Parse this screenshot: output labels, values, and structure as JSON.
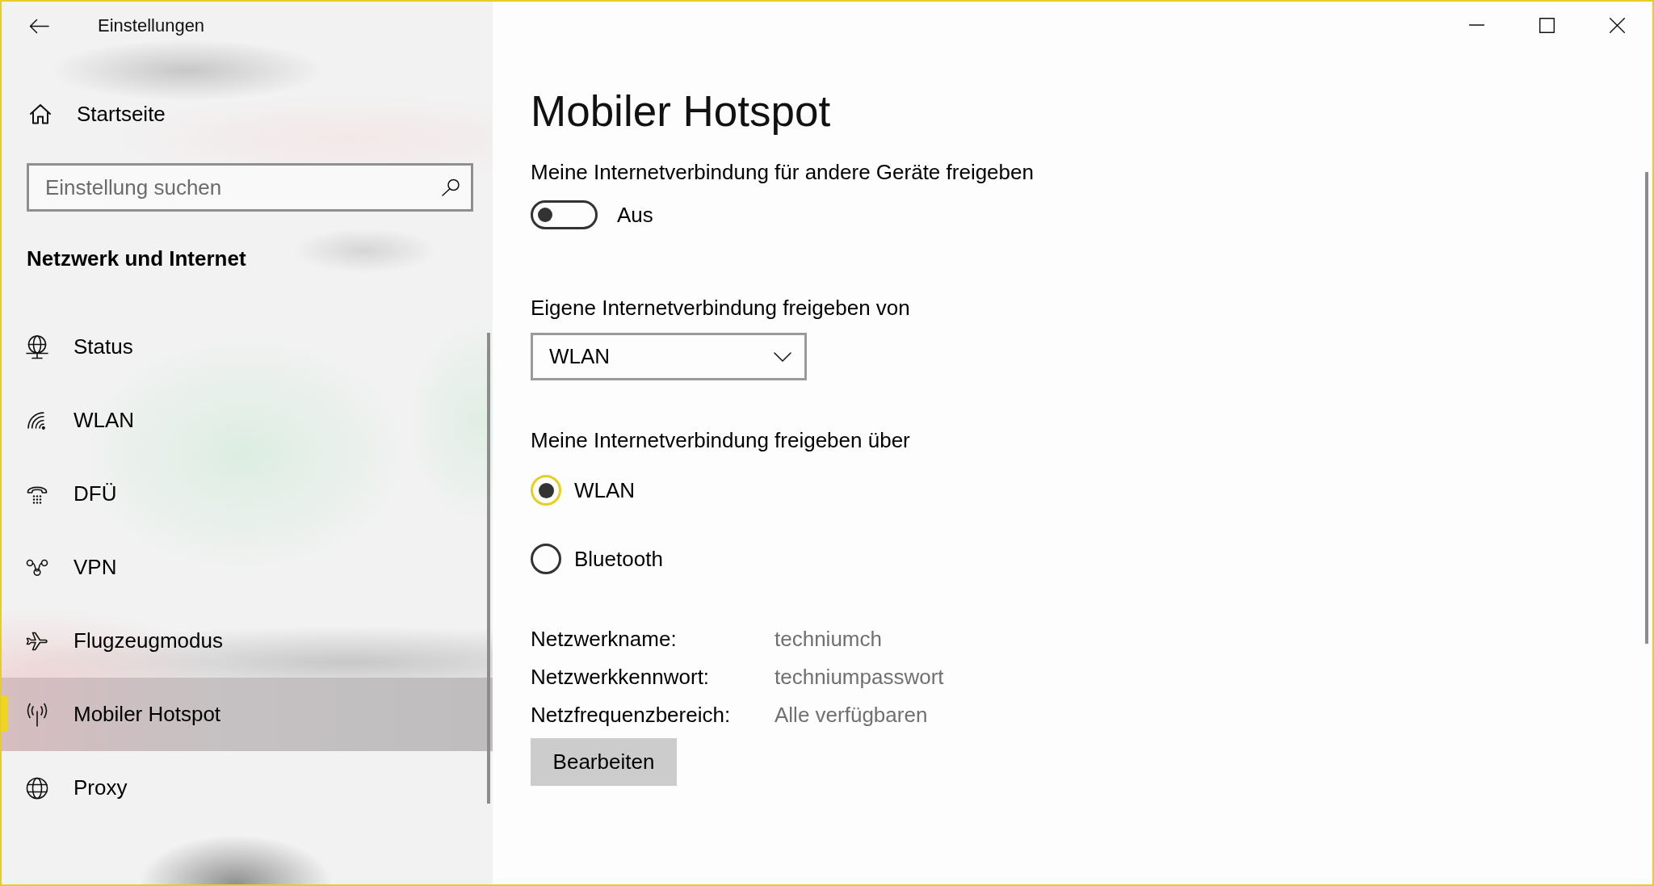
{
  "window": {
    "title": "Einstellungen"
  },
  "sidebar": {
    "home": {
      "label": "Startseite"
    },
    "search": {
      "placeholder": "Einstellung suchen"
    },
    "section_title": "Netzwerk und Internet",
    "items": [
      {
        "label": "Status",
        "selected": false
      },
      {
        "label": "WLAN",
        "selected": false
      },
      {
        "label": "DFÜ",
        "selected": false
      },
      {
        "label": "VPN",
        "selected": false
      },
      {
        "label": "Flugzeugmodus",
        "selected": false
      },
      {
        "label": "Mobiler Hotspot",
        "selected": true
      },
      {
        "label": "Proxy",
        "selected": false
      }
    ]
  },
  "page": {
    "title": "Mobiler Hotspot",
    "share_toggle": {
      "label": "Meine Internetverbindung für andere Geräte freigeben",
      "on": false,
      "state_text": "Aus"
    },
    "share_from": {
      "label": "Eigene Internetverbindung freigeben von",
      "value": "WLAN"
    },
    "share_over": {
      "label": "Meine Internetverbindung freigeben über",
      "options": [
        {
          "label": "WLAN",
          "selected": true
        },
        {
          "label": "Bluetooth",
          "selected": false
        }
      ]
    },
    "properties": [
      {
        "label": "Netzwerkname:",
        "value": "techniumch"
      },
      {
        "label": "Netzwerkkennwort:",
        "value": "techniumpasswort"
      },
      {
        "label": "Netzfrequenzbereich:",
        "value": "Alle verfügbaren"
      }
    ],
    "edit_button": {
      "label": "Bearbeiten"
    }
  }
}
